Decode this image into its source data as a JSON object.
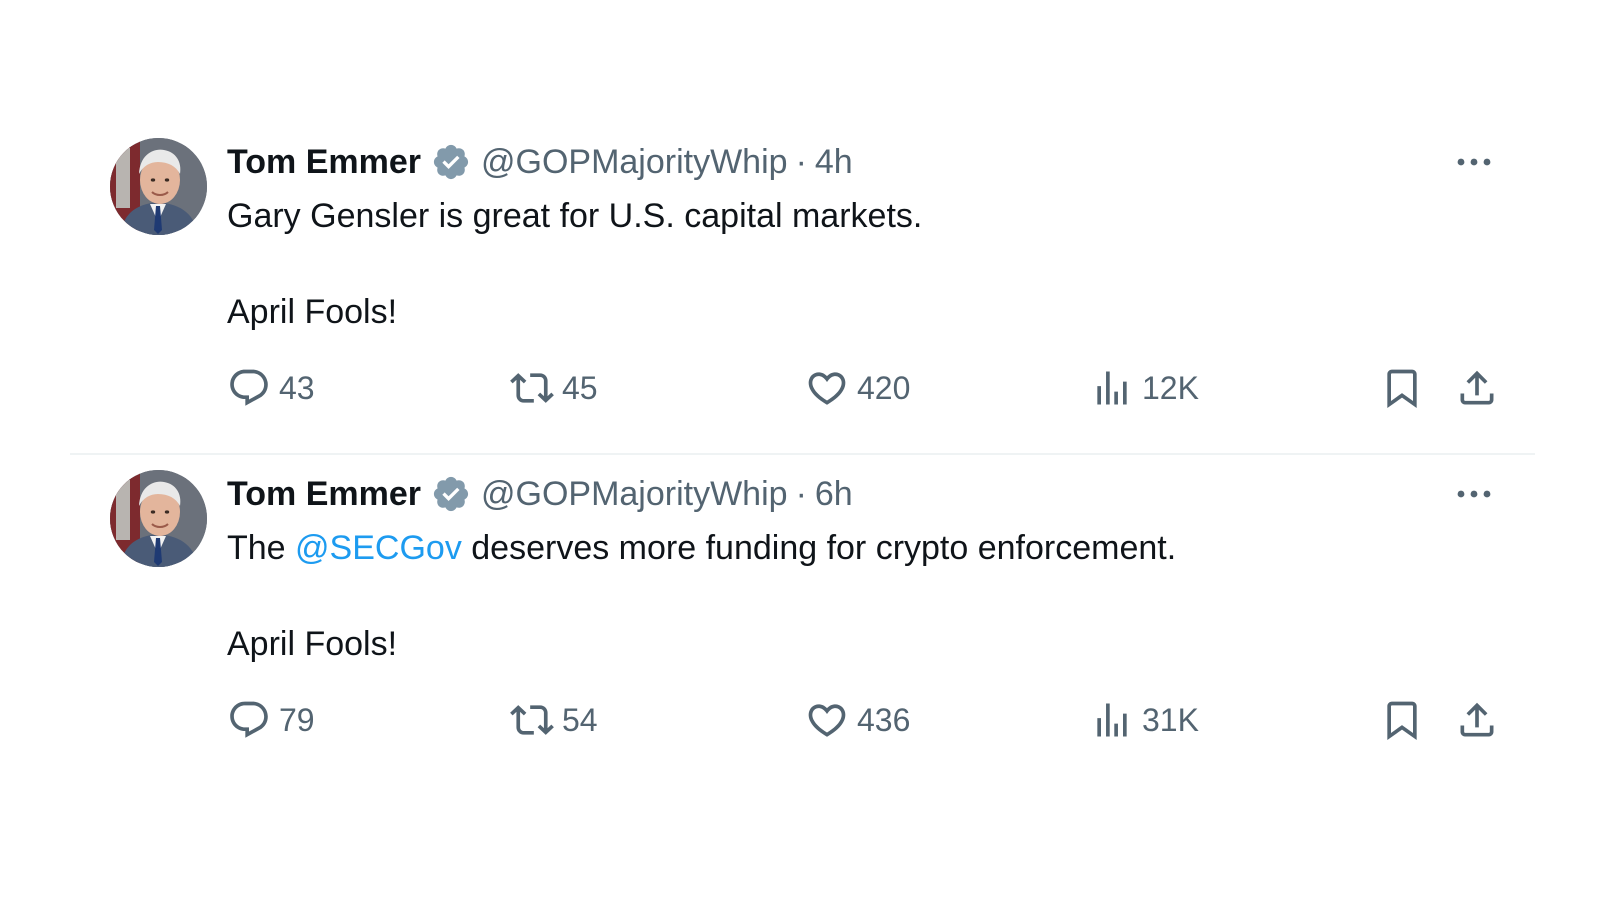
{
  "colors": {
    "text_primary": "#0f1419",
    "text_secondary": "#536471",
    "link": "#1d9bf0",
    "verified_badge": "#829aab",
    "divider": "#eff3f4"
  },
  "icons": {
    "reply": "speech-bubble",
    "retweet": "two-arrows-loop",
    "like": "heart-outline",
    "views": "bar-chart",
    "bookmark": "bookmark-outline",
    "share": "upload-arrow",
    "more": "three-dots",
    "verified": "badge-check"
  },
  "tweets": [
    {
      "author": {
        "name": "Tom Emmer",
        "handle": "@GOPMajorityWhip"
      },
      "separator": "·",
      "timestamp": "4h",
      "body": {
        "line1": "Gary Gensler is great for U.S. capital markets.",
        "line2": "April Fools!"
      },
      "stats": {
        "replies": "43",
        "retweets": "45",
        "likes": "420",
        "views": "12K"
      }
    },
    {
      "author": {
        "name": "Tom Emmer",
        "handle": "@GOPMajorityWhip"
      },
      "separator": "·",
      "timestamp": "6h",
      "body": {
        "prefix": "The ",
        "mention": "@SECGov",
        "suffix": " deserves more funding for crypto enforcement.",
        "line2": "April Fools!"
      },
      "stats": {
        "replies": "79",
        "retweets": "54",
        "likes": "436",
        "views": "31K"
      }
    }
  ]
}
